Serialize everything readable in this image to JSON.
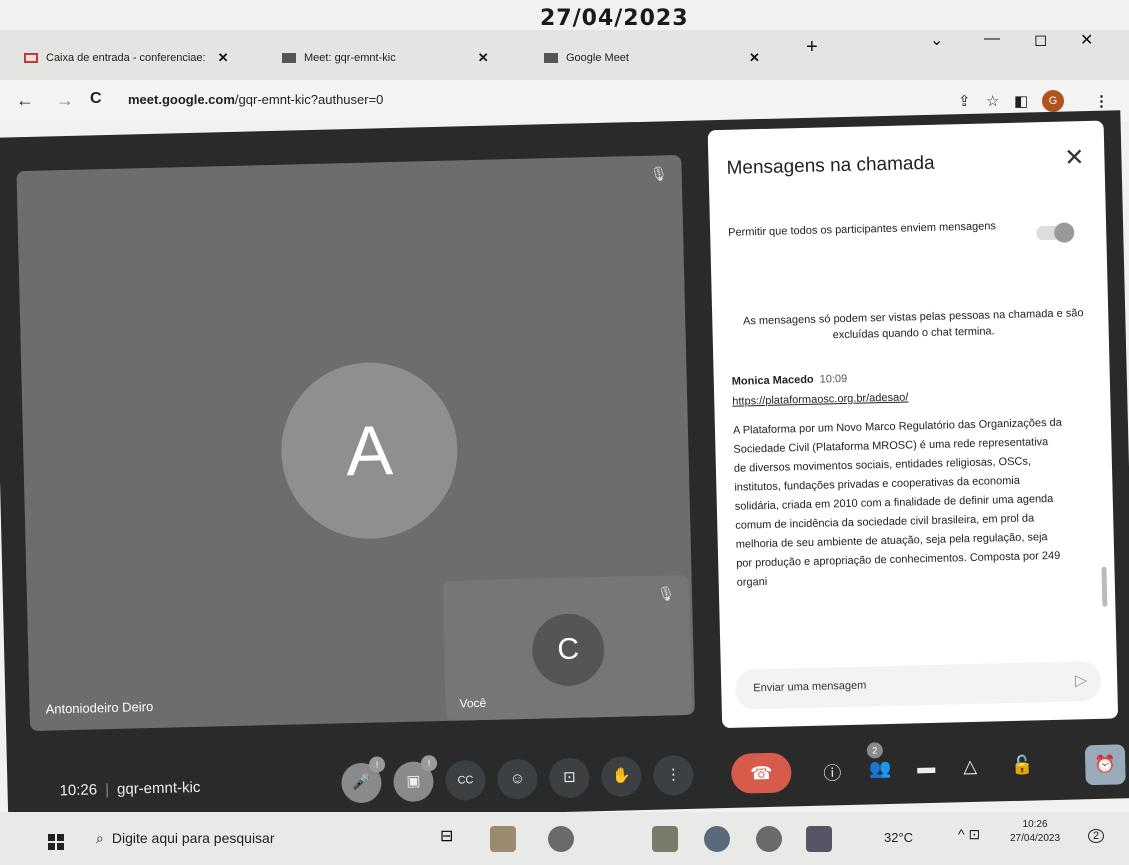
{
  "stamp_date": "27/04/2023",
  "tabs": [
    {
      "label": "Caixa de entrada - conferenciae:",
      "close": "✕"
    },
    {
      "label": "Meet: gqr-emnt-kic",
      "close": "✕"
    },
    {
      "label": "Google Meet",
      "close": "✕"
    }
  ],
  "new_tab": "+",
  "window": {
    "chevron": "⌄",
    "minimize": "—",
    "maximize": "◻",
    "close": "✕"
  },
  "address": {
    "back": "←",
    "forward": "→",
    "reload": "C",
    "lock": "🔒",
    "host": "meet.google.com",
    "path": "/gqr-emnt-kic?authuser=0"
  },
  "toolbar": {
    "share": "⇪",
    "star": "☆",
    "sidepanel": "◧",
    "profile_initial": "G",
    "menu": "⋮"
  },
  "meet": {
    "main_tile": {
      "initial": "A",
      "name": "Antoniodeiro Deiro"
    },
    "self_tile": {
      "initial": "C",
      "name": "Você"
    },
    "mic_off_icon": "🎙"
  },
  "chat": {
    "title": "Mensagens na chamada",
    "close": "✕",
    "permission_label": "Permitir que todos os participantes enviem mensagens",
    "notice": "As mensagens só podem ser vistas pelas pessoas na chamada e são excluídas quando o chat termina.",
    "sender": "Monica Macedo",
    "time": "10:09",
    "link": "https://plataformaosc.org.br/adesao/",
    "message": "A Plataforma por um Novo Marco Regulatório das Organizações da Sociedade Civil (Plataforma MROSC) é uma rede representativa de diversos movimentos sociais, entidades religiosas, OSCs, institutos, fundações privadas e cooperativas da economia solidária, criada em 2010 com a finalidade de definir uma agenda comum de incidência da sociedade civil brasileira, em prol da melhoria de seu ambiente de atuação, seja pela regulação, seja por produção e apropriação de conhecimentos. Composta por 249 organi",
    "compose_placeholder": "Enviar uma mensagem",
    "send_icon": "▷"
  },
  "bottom": {
    "time": "10:26",
    "separator": "|",
    "meeting_code": "gqr-emnt-kic",
    "buttons": {
      "mic": "🎤",
      "cam": "▣",
      "cc": "CC",
      "emoji": "☺",
      "present": "⊡",
      "hand": "✋",
      "more": "⋮",
      "hangup": "☎"
    },
    "badge_alert": "!",
    "info": "ⓘ",
    "people": "👥",
    "people_count": "2",
    "chat": "▬",
    "activities": "△",
    "lock": "🔓",
    "alarm": "⏰"
  },
  "taskbar": {
    "search_icon": "⌕",
    "search_text": "Digite aqui para pesquisar",
    "taskview": "⊟",
    "weather": "32°C",
    "tray_up": "^",
    "tray_icon": "⊡",
    "clock_time": "10:26",
    "clock_date": "27/04/2023",
    "notif_count": "2"
  }
}
